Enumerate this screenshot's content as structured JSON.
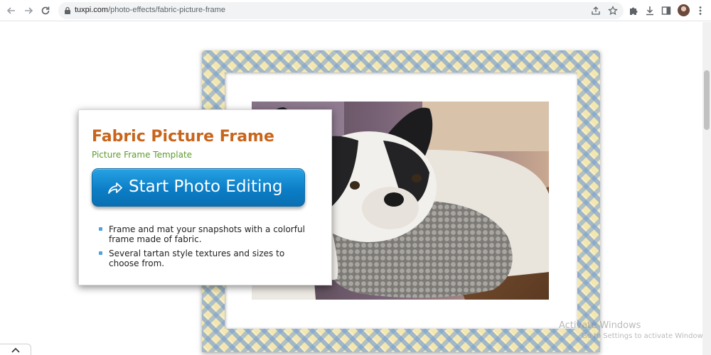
{
  "browser": {
    "url_host": "tuxpi.com",
    "url_path": "/photo-effects/fabric-picture-frame",
    "icons": {
      "back": "arrow-left-icon",
      "forward": "arrow-right-icon",
      "reload": "reload-icon",
      "lock": "lock-icon",
      "share": "share-icon",
      "bookmark": "star-icon",
      "extensions": "puzzle-icon",
      "downloads": "download-icon",
      "side_panel": "side-panel-icon",
      "menu": "kebab-menu-icon"
    }
  },
  "card": {
    "title": "Fabric Picture Frame",
    "subtitle": "Picture Frame Template",
    "cta_label": "Start Photo Editing",
    "features": [
      "Frame and mat your snapshots with a colorful frame made of fabric.",
      "Several tartan style textures and sizes to choose from."
    ]
  },
  "watermark": {
    "line1": "Activate Windows",
    "line2": "Go to Settings to activate Windows."
  },
  "colors": {
    "title": "#c8651b",
    "subtitle": "#5e9a2a",
    "cta": "#0b7ec7",
    "frame_base": "#f3e6b0",
    "frame_pattern": "#78a0d2"
  }
}
